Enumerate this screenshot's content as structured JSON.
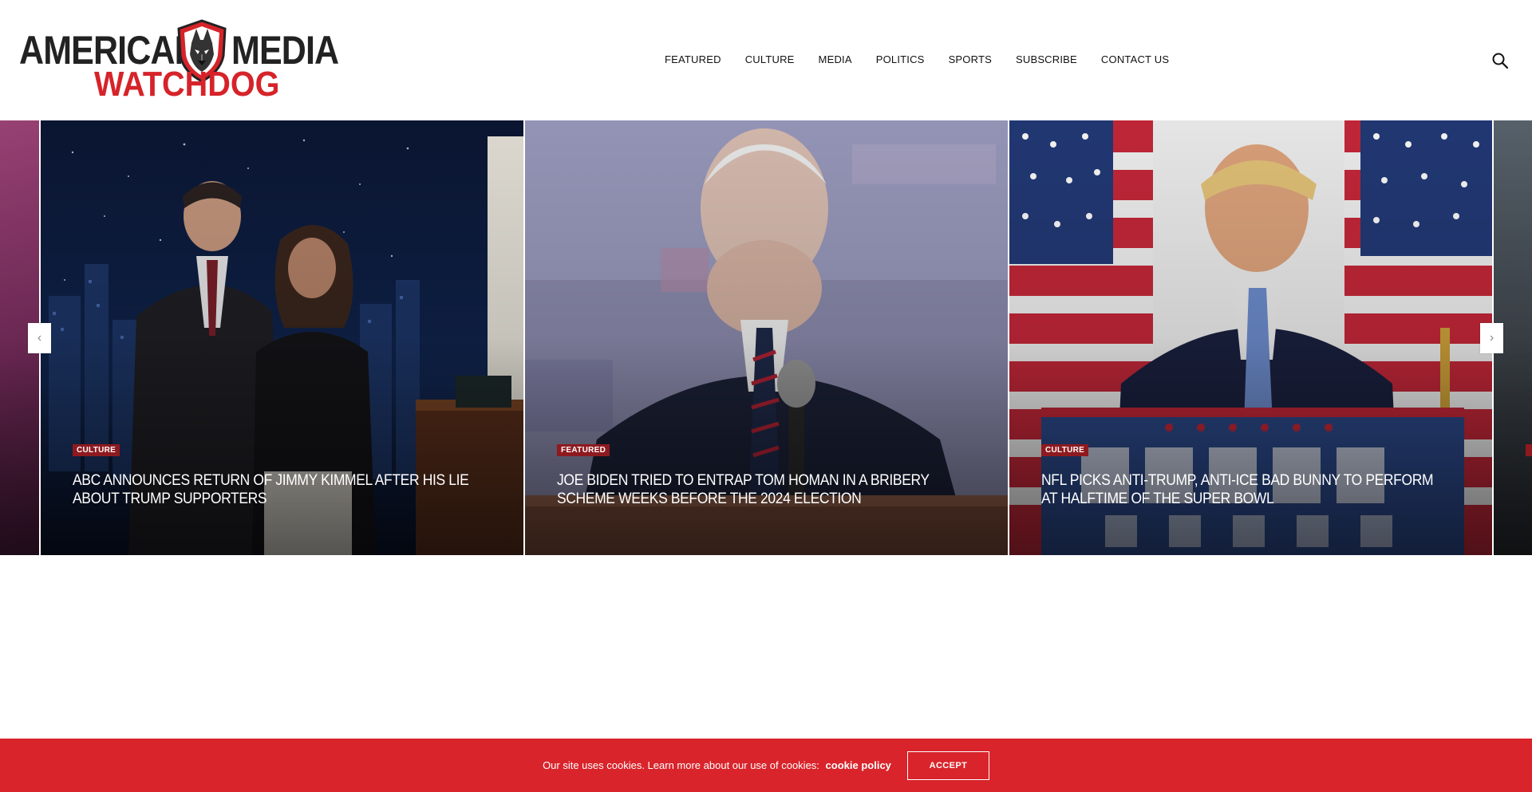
{
  "site": {
    "logo_line1_left": "AMERICAN",
    "logo_line1_right": "MEDIA",
    "logo_line2": "WATCHDOG"
  },
  "nav": {
    "items": [
      {
        "label": "FEATURED"
      },
      {
        "label": "CULTURE"
      },
      {
        "label": "MEDIA"
      },
      {
        "label": "POLITICS"
      },
      {
        "label": "SPORTS"
      },
      {
        "label": "SUBSCRIBE"
      },
      {
        "label": "CONTACT US"
      }
    ],
    "search_icon": "search-icon"
  },
  "slider": {
    "prev_icon": "‹",
    "next_icon": "›",
    "slides": [
      {
        "category": "CULTURE",
        "title": "ABC ANNOUNCES RETURN OF JIMMY KIMMEL AFTER HIS LIE ABOUT TRUMP SUPPORTERS"
      },
      {
        "category": "FEATURED",
        "title": "JOE BIDEN TRIED TO ENTRAP TOM HOMAN IN A BRIBERY SCHEME WEEKS BEFORE THE 2024 ELECTION"
      },
      {
        "category": "CULTURE",
        "title": "NFL PICKS ANTI-TRUMP, ANTI-ICE BAD BUNNY TO PERFORM AT HALFTIME OF THE SUPER BOWL"
      }
    ]
  },
  "cookie": {
    "text": "Our site uses cookies. Learn more about our use of cookies:",
    "link_label": "cookie policy",
    "accept_label": "ACCEPT"
  },
  "colors": {
    "brand_red": "#d9242b",
    "category_badge": "#8e1a1f",
    "logo_dark": "#222222"
  }
}
